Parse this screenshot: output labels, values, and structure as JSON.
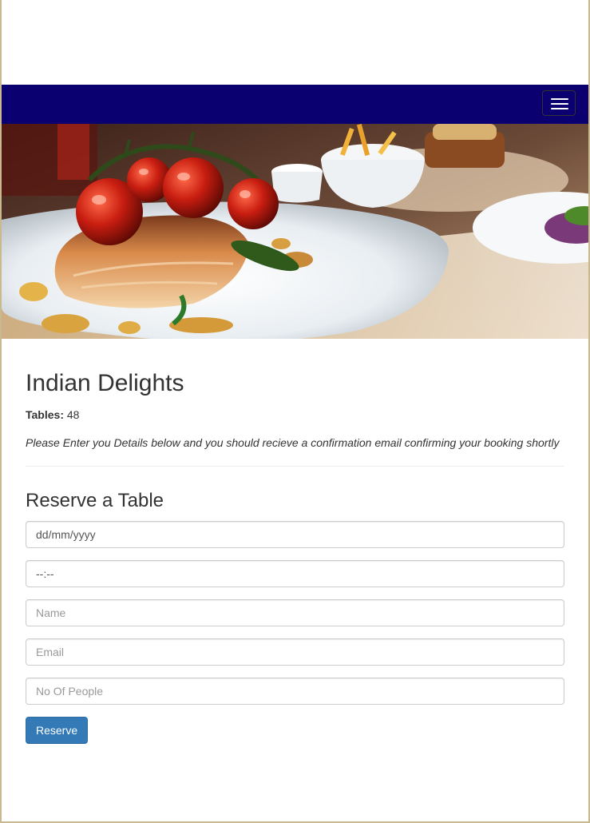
{
  "navbar": {
    "background": "#0a006f",
    "toggle_icon": "hamburger-menu-icon"
  },
  "hero": {
    "image": "plated-fish-dish-with-roasted-cherry-tomatoes"
  },
  "restaurant": {
    "name": "Indian Delights",
    "tables_label": "Tables:",
    "tables_value": "48",
    "note": "Please Enter you Details below and you should recieve a confirmation email confirming your booking shortly"
  },
  "reservation": {
    "heading": "Reserve a Table",
    "date_value": "dd/mm/yyyy",
    "time_value": "--:--",
    "name_placeholder": "Name",
    "email_placeholder": "Email",
    "people_placeholder": "No Of People",
    "submit_label": "Reserve"
  },
  "colors": {
    "primary_button": "#337ab7",
    "frame_border": "#c8b98f"
  }
}
